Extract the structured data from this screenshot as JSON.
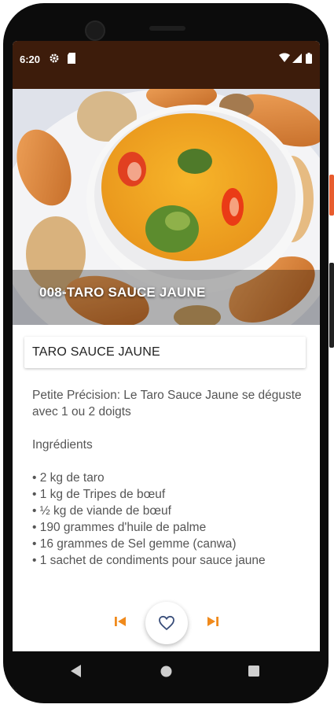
{
  "status_bar": {
    "time": "6:20",
    "icons": [
      "gear-icon",
      "sd-card-icon",
      "wifi-icon",
      "signal-icon",
      "battery-icon"
    ]
  },
  "hero": {
    "title": "008-TARO SAUCE JAUNE"
  },
  "recipe": {
    "title": "TARO SAUCE JAUNE",
    "note": "Petite Précision: Le Taro Sauce Jaune se déguste avec 1 ou 2 doigts",
    "ingredients_heading": "Ingrédients",
    "ingredients": [
      "• 2 kg de taro",
      "• 1 kg de Tripes de bœuf",
      "• ½ kg de viande de bœuf",
      "• 190 grammes d'huile de palme",
      "• 16 grammes de Sel gemme (canwa)",
      "• 1 sachet de condiments pour sauce jaune"
    ]
  },
  "controls": {
    "previous_icon": "skip-previous-icon",
    "favorite_icon": "heart-outline-icon",
    "next_icon": "skip-next-icon",
    "accent_color": "#f08a1c"
  },
  "navigation": {
    "icons": [
      "back-icon",
      "home-icon",
      "recents-icon"
    ]
  },
  "colors": {
    "status_bar": "#3d1c0b",
    "card_background": "#ffffff",
    "body_text": "#555555"
  }
}
